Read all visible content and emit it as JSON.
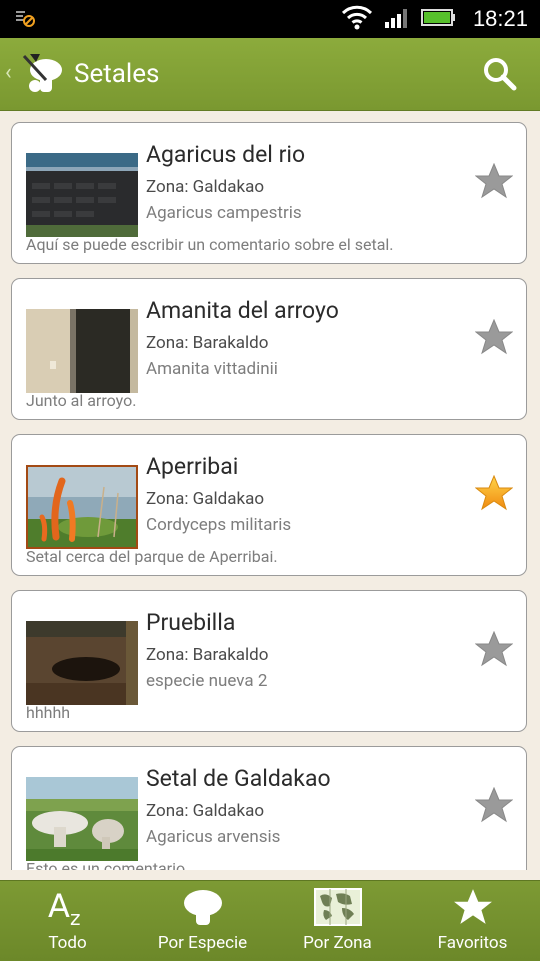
{
  "status_bar": {
    "time": "18:21"
  },
  "action_bar": {
    "title": "Setales"
  },
  "items": [
    {
      "title": "Agaricus del rio",
      "zone": "Zona: Galdakao",
      "species": "Agaricus campestris",
      "comment": "Aquí se puede escribir un comentario sobre el setal.",
      "favorite": false
    },
    {
      "title": "Amanita del arroyo",
      "zone": "Zona: Barakaldo",
      "species": "Amanita vittadinii",
      "comment": "Junto al arroyo.",
      "favorite": false
    },
    {
      "title": "Aperribai",
      "zone": "Zona: Galdakao",
      "species": "Cordyceps militaris",
      "comment": "Setal cerca del parque de Aperribai.",
      "favorite": true
    },
    {
      "title": "Pruebilla",
      "zone": "Zona: Barakaldo",
      "species": "especie nueva 2",
      "comment": "hhhhh",
      "favorite": false
    },
    {
      "title": "Setal de Galdakao",
      "zone": "Zona: Galdakao",
      "species": "Agaricus arvensis",
      "comment": "Esto es un comentario",
      "favorite": false
    }
  ],
  "tabs": [
    {
      "label": "Todo",
      "icon": "az-icon"
    },
    {
      "label": "Por Especie",
      "icon": "mushroom-icon"
    },
    {
      "label": "Por Zona",
      "icon": "map-icon"
    },
    {
      "label": "Favoritos",
      "icon": "star-icon"
    }
  ],
  "colors": {
    "accent": "#7f9d33",
    "favorite_star": "#f5a623",
    "inactive_star": "#9a9a9a"
  }
}
